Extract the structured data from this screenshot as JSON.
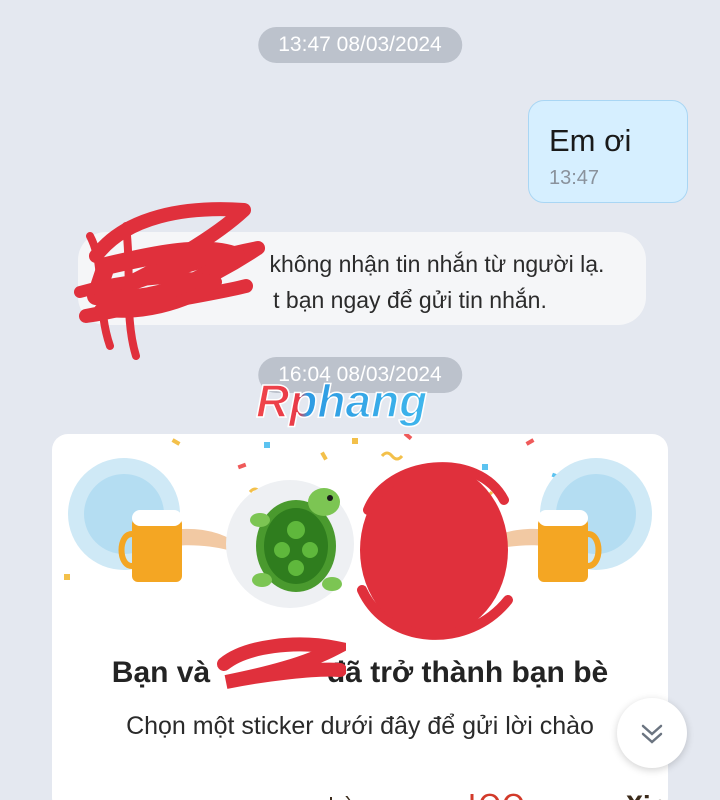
{
  "chat": {
    "timestamp_1": "13:47 08/03/2024",
    "timestamp_2": "16:04 08/03/2024",
    "outgoing_message": {
      "text": "Em ơi",
      "time": "13:47"
    },
    "system_note": {
      "line_1": "không nhận tin nhắn từ người lạ.",
      "line_2": "t bạn ngay để gửi tin nhắn."
    },
    "watermark": "Rphang"
  },
  "friend_card": {
    "title_prefix": "Bạn và",
    "title_suffix": "đã trở thành bạn bè",
    "subtitle": "Chọn một sticker dưới đây để gửi lời chào",
    "avatar_icon": "turtle-avatar-icon",
    "decor_icon": "beer-mug-icon"
  },
  "colors": {
    "background": "#e4e8f0",
    "outgoing_bubble": "#d6efff",
    "redaction": "#e0303c",
    "timestamp_pill": "#bcc2cc"
  }
}
